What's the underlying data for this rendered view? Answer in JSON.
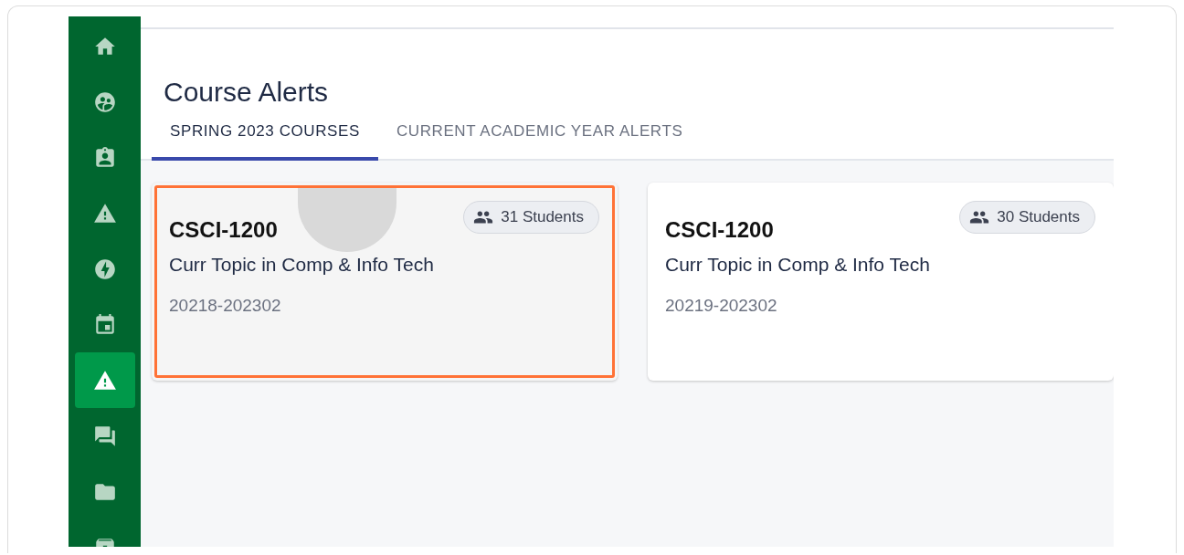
{
  "sidebar": {
    "items": [
      {
        "selected": false
      },
      {
        "selected": false
      },
      {
        "selected": false
      },
      {
        "selected": false
      },
      {
        "selected": false
      },
      {
        "selected": false
      },
      {
        "selected": true
      },
      {
        "selected": false
      },
      {
        "selected": false
      },
      {
        "selected": false
      }
    ]
  },
  "page": {
    "title": "Course Alerts"
  },
  "tabs": [
    {
      "label": "SPRING 2023 COURSES",
      "selected": true
    },
    {
      "label": "CURRENT ACADEMIC YEAR ALERTS",
      "selected": false
    }
  ],
  "courses": [
    {
      "code": "CSCI-1200",
      "name": "Curr Topic in Comp & Info Tech",
      "term": "20218-202302",
      "students": "31 Students",
      "highlighted": true
    },
    {
      "code": "CSCI-1200",
      "name": "Curr Topic in Comp & Info Tech",
      "term": "20219-202302",
      "students": "30 Students",
      "highlighted": false
    }
  ]
}
